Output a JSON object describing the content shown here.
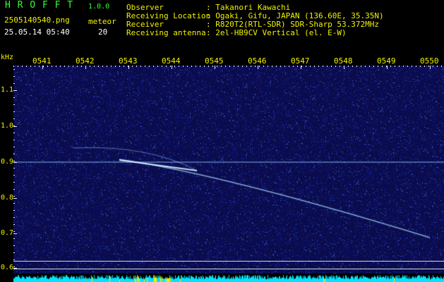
{
  "app": {
    "name": "H R O F F T",
    "version": "1.0.0",
    "filename": "2505140540.png",
    "datetime": "25.05.14 05:40",
    "count_label": "meteor",
    "count_value": "20"
  },
  "info": {
    "observer_label": "Observer",
    "observer_value": ": Takanori Kawachi",
    "location_label": "Receiving Location",
    "location_value": ": Ogaki, Gifu, JAPAN (136.60E, 35.35N)",
    "receiver_label": "Receiver",
    "receiver_value": ": R820T2(RTL-SDR) SDR-Sharp 53.372MHz",
    "antenna_label": "Receiving antenna",
    "antenna_value": ": 2el-HB9CV Vertical (el. E-W)"
  },
  "axis": {
    "y_unit": "kHz",
    "y_ticks": [
      "1.1",
      "1.0",
      "0.9",
      "0.8",
      "0.7",
      "0.6"
    ],
    "x_ticks": [
      "0541",
      "0542",
      "0543",
      "0544",
      "0545",
      "0546",
      "0547",
      "0548",
      "0549",
      "0550"
    ]
  },
  "colors": {
    "background": "#000000",
    "spectrogram_bg": "#0b0d4a",
    "title_green": "#33ff33",
    "label_yellow": "#f2f200",
    "trace_light": "#bfe8ff",
    "baseline_cyan": "#00e5ff"
  }
}
